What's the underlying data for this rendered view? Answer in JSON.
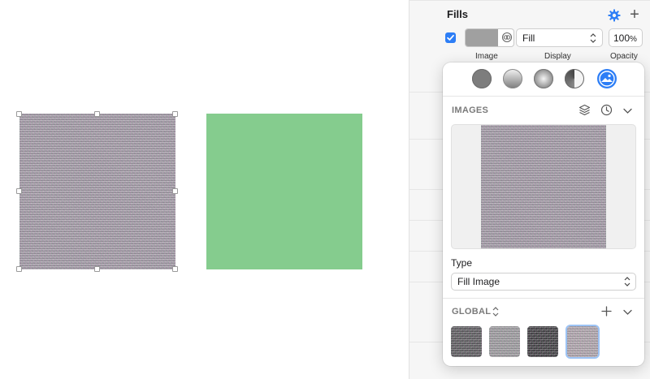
{
  "inspector": {
    "fills": {
      "title": "Fills",
      "enabled": true,
      "display_value": "Fill",
      "opacity_value": "100",
      "opacity_unit": "%",
      "labels": {
        "image": "Image",
        "display": "Display",
        "opacity": "Opacity"
      }
    }
  },
  "popover": {
    "fill_types": [
      "solid-fill-icon",
      "linear-gradient-icon",
      "radial-gradient-icon",
      "angular-gradient-icon",
      "image-fill-icon"
    ],
    "images": {
      "label": "IMAGES"
    },
    "type": {
      "label": "Type",
      "value": "Fill Image"
    },
    "global": {
      "label": "GLOBAL"
    }
  },
  "colors": {
    "accent": "#2d7ef6",
    "green_shape": "#85cc8e",
    "selected_ring": "#9cc3f5"
  }
}
